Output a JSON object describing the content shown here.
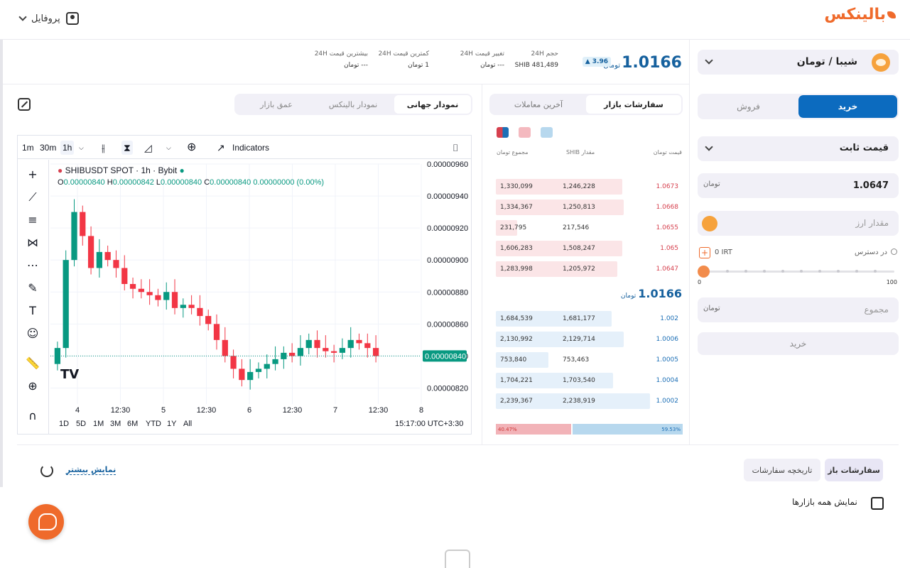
{
  "header": {
    "logo_text": "بالینکس",
    "profile_label": "پروفایل"
  },
  "market": {
    "name": "شیبا / تومان",
    "icon": "shiba-coin-icon"
  },
  "ticker": {
    "last_price": "1.0166",
    "unit": "تومان",
    "change_pct": "3.96",
    "stats": [
      {
        "title": "حجم 24H",
        "value": "SHIB 481,489"
      },
      {
        "title": "تغییر قیمت 24H",
        "value": "--- تومان"
      },
      {
        "title": "کمترین قیمت 24H",
        "value": "1 تومان"
      },
      {
        "title": "بیشترین قیمت 24H",
        "value": "--- تومان"
      }
    ]
  },
  "order_form": {
    "buy_label": "خرید",
    "sell_label": "فروش",
    "order_type": "قیمت ثابت",
    "price_value": "1.0647",
    "price_unit": "تومان",
    "amount_placeholder": "مقدار ارز",
    "available_label": "در دسترس",
    "available_amount": "0 IRT",
    "slider_min": "0",
    "slider_max": "100",
    "slider_value_pct": 0,
    "total_placeholder": "مجموع",
    "total_unit": "تومان",
    "submit_label": "خرید"
  },
  "order_book": {
    "tab_orders": "سفارشات بازار",
    "tab_trades": "آخرین معاملات",
    "col_price": "قیمت تومان",
    "col_amount": "مقدار SHIB",
    "col_total": "مجموع تومان",
    "asks": [
      {
        "total": "1,330,099",
        "amount": "1,246,228",
        "price": "1.0673",
        "depth": 0.82
      },
      {
        "total": "1,334,367",
        "amount": "1,250,813",
        "price": "1.0668",
        "depth": 0.83
      },
      {
        "total": "231,795",
        "amount": "217,546",
        "price": "1.0655",
        "depth": 0.14
      },
      {
        "total": "1,606,283",
        "amount": "1,508,247",
        "price": "1.065",
        "depth": 0.82
      },
      {
        "total": "1,283,998",
        "amount": "1,205,972",
        "price": "1.0647",
        "depth": 0.79
      }
    ],
    "mid_price": "1.0166",
    "mid_unit": "تومان",
    "bids": [
      {
        "total": "1,684,539",
        "amount": "1,681,177",
        "price": "1.002",
        "depth": 0.75
      },
      {
        "total": "2,130,992",
        "amount": "2,129,714",
        "price": "1.0006",
        "depth": 0.83
      },
      {
        "total": "753,840",
        "amount": "753,463",
        "price": "1.0005",
        "depth": 0.34
      },
      {
        "total": "1,704,221",
        "amount": "1,703,540",
        "price": "1.0004",
        "depth": 0.76
      },
      {
        "total": "2,239,367",
        "amount": "2,238,919",
        "price": "1.0002",
        "depth": 1.0
      }
    ],
    "sell_ratio": "40.47%",
    "buy_ratio": "59.53%",
    "sell_ratio_value": 40.47
  },
  "chart_tabs": {
    "global": "نمودار جهانی",
    "balinex": "نمودار بالینکس",
    "depth": "عمق بازار"
  },
  "tv": {
    "intervals": [
      "1m",
      "30m",
      "1h"
    ],
    "selected_interval": "1h",
    "indicators_label": "Indicators",
    "symbol_line": "SHIBUSDT SPOT · 1h · Bybit",
    "ohlc": {
      "O": "0.00000840",
      "H": "0.00000842",
      "L": "0.00000840",
      "C": "0.00000840",
      "chg": "0.00000000 (0.00%)"
    },
    "ranges": [
      "1D",
      "5D",
      "1M",
      "3M",
      "6M",
      "YTD",
      "1Y",
      "All"
    ],
    "clock": "15:17:00 UTC+3:30"
  },
  "chart_data": {
    "type": "candlestick",
    "symbol": "SHIBUSDT",
    "ylim": [
      8.1e-06,
      9.6e-06
    ],
    "y_ticks": [
      "0.00000960",
      "0.00000940",
      "0.00000920",
      "0.00000900",
      "0.00000880",
      "0.00000860",
      "0.00000840",
      "0.00000820"
    ],
    "x_ticks": [
      "4",
      "12:30",
      "5",
      "12:30",
      "6",
      "12:30",
      "7",
      "12:30",
      "8"
    ],
    "last_price_label": "0.00000840",
    "closes": [
      8.45e-06,
      9e-06,
      9.3e-06,
      9.15e-06,
      8.95e-06,
      9.05e-06,
      9e-06,
      8.95e-06,
      8.85e-06,
      8.82e-06,
      8.8e-06,
      8.78e-06,
      8.75e-06,
      8.8e-06,
      8.7e-06,
      8.72e-06,
      8.7e-06,
      8.65e-06,
      8.6e-06,
      8.5e-06,
      8.4e-06,
      8.32e-06,
      8.25e-06,
      8.3e-06,
      8.32e-06,
      8.35e-06,
      8.38e-06,
      8.42e-06,
      8.4e-06,
      8.45e-06,
      8.5e-06,
      8.45e-06,
      8.43e-06,
      8.42e-06,
      8.45e-06,
      8.5e-06,
      8.48e-06,
      8.45e-06,
      8.4e-06
    ]
  },
  "bottom": {
    "open_orders": "سفارشات باز",
    "order_history": "تاریخچه سفارشات",
    "show_more": "نمایش بیشتر",
    "show_all_markets": "نمایش همه بازارها"
  }
}
